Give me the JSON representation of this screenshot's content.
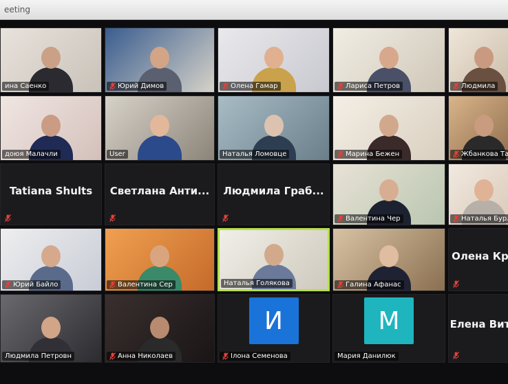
{
  "window": {
    "title": "eeting"
  },
  "colors": {
    "active_speaker": "#b5e04a",
    "mute": "#e5403b"
  },
  "participants": [
    {
      "id": "p0",
      "label": "ина Саенко",
      "video": true,
      "muted": false,
      "bg": [
        "#e8e2dc",
        "#c9c2b9"
      ],
      "skin": "#caa186",
      "shirt": "#2a2a30"
    },
    {
      "id": "p1",
      "label": "Юрий Димов",
      "video": true,
      "muted": true,
      "bg": [
        "#3a5d8f",
        "#d6d2c8"
      ],
      "skin": "#d4a487",
      "shirt": "#5b6070"
    },
    {
      "id": "p2",
      "label": "Олена Гамар",
      "video": true,
      "muted": true,
      "bg": [
        "#e9e9ec",
        "#c8c8d0"
      ],
      "skin": "#e0b090",
      "shirt": "#c9a24b"
    },
    {
      "id": "p3",
      "label": "Лариса Петров",
      "video": true,
      "muted": true,
      "bg": [
        "#f1ede4",
        "#cfc7b8"
      ],
      "skin": "#d8a88c",
      "shirt": "#4a5068"
    },
    {
      "id": "p4",
      "label": "Людмила",
      "video": true,
      "muted": true,
      "bg": [
        "#efe6d9",
        "#c8b9a6"
      ],
      "skin": "#c99a80",
      "shirt": "#6a5040"
    },
    {
      "id": "p5",
      "label": "доюя Малачли",
      "video": true,
      "muted": false,
      "bg": [
        "#f0e6e2",
        "#d4c0bb"
      ],
      "skin": "#c99c83",
      "shirt": "#1f2a55"
    },
    {
      "id": "p6",
      "label": "User",
      "video": true,
      "muted": false,
      "bg": [
        "#d7d2c9",
        "#8c8479"
      ],
      "skin": "#e2b79a",
      "shirt": "#2b4a8c"
    },
    {
      "id": "p7",
      "label": "Наталья Ломовце",
      "video": true,
      "muted": false,
      "bg": [
        "#a8bcc6",
        "#6a7f8a"
      ],
      "skin": "#dcc3b0",
      "shirt": "#2e3e52"
    },
    {
      "id": "p8",
      "label": "Марина Бежен",
      "video": true,
      "muted": true,
      "bg": [
        "#f4efe6",
        "#d9cfbf"
      ],
      "skin": "#d2a88d",
      "shirt": "#3a2a2a"
    },
    {
      "id": "p9",
      "label": "Жбанкова Тать",
      "video": true,
      "muted": true,
      "bg": [
        "#d9b48a",
        "#8a6a4a"
      ],
      "skin": "#c99c80",
      "shirt": "#2a2a2a"
    },
    {
      "id": "p10",
      "label": "",
      "name_text": "Tatiana Shults",
      "video": false,
      "muted": true
    },
    {
      "id": "p11",
      "label": "",
      "name_text": "Светлана  Анти...",
      "video": false,
      "muted": true
    },
    {
      "id": "p12",
      "label": "",
      "name_text": "Людмила  Граб...",
      "video": false,
      "muted": true
    },
    {
      "id": "p13",
      "label": "Валентина Чер",
      "video": true,
      "muted": true,
      "bg": [
        "#e8e2d6",
        "#b9c6b0"
      ],
      "skin": "#d8ae92",
      "shirt": "#1d2230"
    },
    {
      "id": "p14",
      "label": "Наталья Бурла",
      "video": true,
      "muted": true,
      "bg": [
        "#f1e9e0",
        "#d8c7b6"
      ],
      "skin": "#e0b396",
      "shirt": "#b7b0a8"
    },
    {
      "id": "p15",
      "label": "Юрий Байло",
      "video": true,
      "muted": true,
      "bg": [
        "#eeeeef",
        "#c8ccd6"
      ],
      "skin": "#d6a98d",
      "shirt": "#5a6a8a"
    },
    {
      "id": "p16",
      "label": "Валентина Сер",
      "video": true,
      "muted": true,
      "bg": [
        "#f0a050",
        "#c56a2a"
      ],
      "skin": "#d9a57f",
      "shirt": "#3a8a6a"
    },
    {
      "id": "p17",
      "label": "Наталья Голякова",
      "video": true,
      "muted": false,
      "active": true,
      "bg": [
        "#f0efe8",
        "#cfc9bd"
      ],
      "skin": "#d3a98c",
      "shirt": "#6b7a9a"
    },
    {
      "id": "p18",
      "label": "Галина Афанас",
      "video": true,
      "muted": true,
      "bg": [
        "#d8c2a4",
        "#8a7050"
      ],
      "skin": "#e0bca0",
      "shirt": "#1f2233"
    },
    {
      "id": "p19",
      "label": "",
      "name_text": "Олена  Кра",
      "video": false,
      "muted": true
    },
    {
      "id": "p20",
      "label": "Людмила Петровн",
      "video": true,
      "muted": false,
      "bg": [
        "#6a6a6e",
        "#2c2c30"
      ],
      "skin": "#d2a488",
      "shirt": "#303036"
    },
    {
      "id": "p21",
      "label": "Анна Николаев",
      "video": true,
      "muted": true,
      "bg": [
        "#3a2f2f",
        "#1a1515"
      ],
      "skin": "#b88a70",
      "shirt": "#2a2a2a"
    },
    {
      "id": "p22",
      "label": "Ілона Семенова",
      "video": false,
      "muted": true,
      "avatar": "И",
      "avatar_color": "#1a73d9"
    },
    {
      "id": "p23",
      "label": "Мария Данилюк",
      "video": false,
      "muted": false,
      "avatar": "М",
      "avatar_color": "#1fb5bf"
    },
    {
      "id": "p24",
      "label": "",
      "name_text": "Елена  Вита",
      "video": false,
      "muted": true
    }
  ]
}
